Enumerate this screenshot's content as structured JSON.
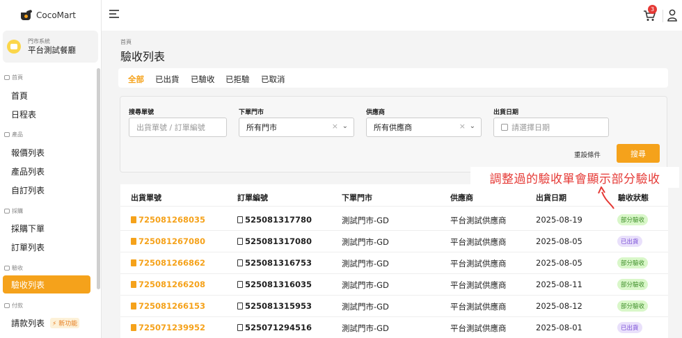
{
  "app": {
    "name": "CocoMart"
  },
  "store": {
    "system_label": "門市系統",
    "name": "平台測試餐廳"
  },
  "sidebar": {
    "groups": [
      {
        "label": "首頁",
        "items": [
          "首頁",
          "日程表"
        ]
      },
      {
        "label": "產品",
        "items": [
          "報價列表",
          "產品列表",
          "自訂列表"
        ]
      },
      {
        "label": "採購",
        "items": [
          "採購下單",
          "訂單列表"
        ]
      },
      {
        "label": "驗收",
        "items": [
          "驗收列表"
        ]
      },
      {
        "label": "付款",
        "items": [
          "請款列表"
        ]
      }
    ],
    "active_item": "驗收列表",
    "new_feature_badge": "⚡ 新功能"
  },
  "topbar": {
    "cart_count": "3"
  },
  "breadcrumb": "首頁",
  "page_title": "驗收列表",
  "tabs": [
    "全部",
    "已出貨",
    "已驗收",
    "已拒驗",
    "已取消"
  ],
  "active_tab": "全部",
  "filters": {
    "search_label": "搜尋單號",
    "search_placeholder": "出貨單號 / 訂單編號",
    "store_label": "下單門市",
    "store_value": "所有門市",
    "supplier_label": "供應商",
    "supplier_value": "所有供應商",
    "date_label": "出貨日期",
    "date_placeholder": "請選擇日期",
    "reset_label": "重設條件",
    "search_button": "搜尋"
  },
  "annotation": "調整過的驗收單會顯示部分驗收",
  "table": {
    "columns": [
      "出貨單號",
      "訂單編號",
      "下單門市",
      "供應商",
      "出貨日期",
      "驗收狀態"
    ],
    "rows": [
      {
        "ship": "725081268035",
        "order": "525081317780",
        "store": "測試門市-GD",
        "supplier": "平台測試供應商",
        "date": "2025-08-19",
        "status": "部分驗收"
      },
      {
        "ship": "725081267080",
        "order": "525081317080",
        "store": "測試門市-GD",
        "supplier": "平台測試供應商",
        "date": "2025-08-05",
        "status": "已出貨"
      },
      {
        "ship": "725081266862",
        "order": "525081316753",
        "store": "測試門市-GD",
        "supplier": "平台測試供應商",
        "date": "2025-08-05",
        "status": "部分驗收"
      },
      {
        "ship": "725081266208",
        "order": "525081316035",
        "store": "測試門市-GD",
        "supplier": "平台測試供應商",
        "date": "2025-08-11",
        "status": "部分驗收"
      },
      {
        "ship": "725081266153",
        "order": "525081315953",
        "store": "測試門市-GD",
        "supplier": "平台測試供應商",
        "date": "2025-08-12",
        "status": "部分驗收"
      },
      {
        "ship": "725071239952",
        "order": "525071294516",
        "store": "測試門市-GD",
        "supplier": "平台測試供應商",
        "date": "2025-08-01",
        "status": "已出貨"
      }
    ]
  },
  "colors": {
    "accent": "#f5a21b",
    "annotation": "#e53935",
    "partial_bg": "#d9f7c9",
    "shipped_bg": "#e9e0fb"
  }
}
